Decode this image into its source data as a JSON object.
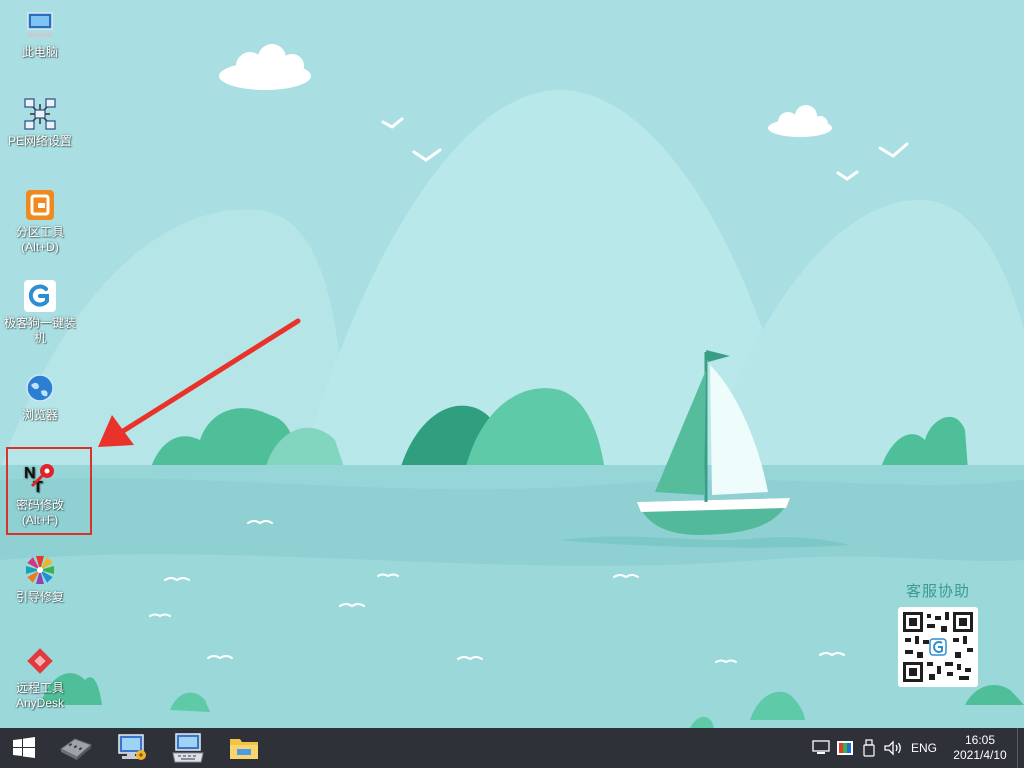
{
  "desktop": {
    "icons": [
      {
        "label": "此电脑",
        "icon": "computer-icon"
      },
      {
        "label": "PE网络设置",
        "icon": "network-icon"
      },
      {
        "label": "分区工具\n(Alt+D)",
        "icon": "partition-tool-icon"
      },
      {
        "label": "极客狗一键装机",
        "icon": "geekdog-installer-icon"
      },
      {
        "label": "浏览器",
        "icon": "browser-icon"
      },
      {
        "label": "密码修改\n(Alt+F)",
        "icon": "password-reset-icon"
      },
      {
        "label": "引导修复",
        "icon": "boot-repair-icon"
      },
      {
        "label": "远程工具\nAnyDesk",
        "icon": "anydesk-icon"
      }
    ],
    "qr_title": "客服协助"
  },
  "taskbar": {
    "pinned": [
      "windows-start-icon",
      "drive-tool-icon",
      "network-monitor-icon",
      "keyboard-icon",
      "file-explorer-icon"
    ],
    "tray": {
      "icons": [
        "network-status-icon",
        "display-icon",
        "usb-icon",
        "volume-icon"
      ],
      "language": "ENG",
      "time": "16:05",
      "date": "2021/4/10"
    }
  },
  "colors": {
    "taskbar": "#2e3138",
    "highlight": "#d9322b",
    "sea": "#8fd3d6",
    "hills": "#3fb592"
  }
}
